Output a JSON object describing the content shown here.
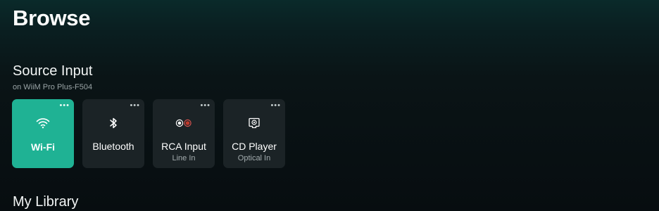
{
  "page": {
    "title": "Browse"
  },
  "source_input": {
    "title": "Source Input",
    "device": "on WiiM Pro Plus-F504",
    "items": [
      {
        "label": "Wi-Fi",
        "sub": "",
        "icon": "wifi-icon",
        "active": true
      },
      {
        "label": "Bluetooth",
        "sub": "",
        "icon": "bluetooth-icon",
        "active": false
      },
      {
        "label": "RCA Input",
        "sub": "Line In",
        "icon": "rca-icon",
        "active": false
      },
      {
        "label": "CD Player",
        "sub": "Optical In",
        "icon": "optical-icon",
        "active": false
      }
    ],
    "more_label": "•••"
  },
  "library": {
    "title": "My Library"
  },
  "colors": {
    "accent": "#1fb294",
    "card": "#1b2326",
    "rca_red": "#c0392b"
  }
}
